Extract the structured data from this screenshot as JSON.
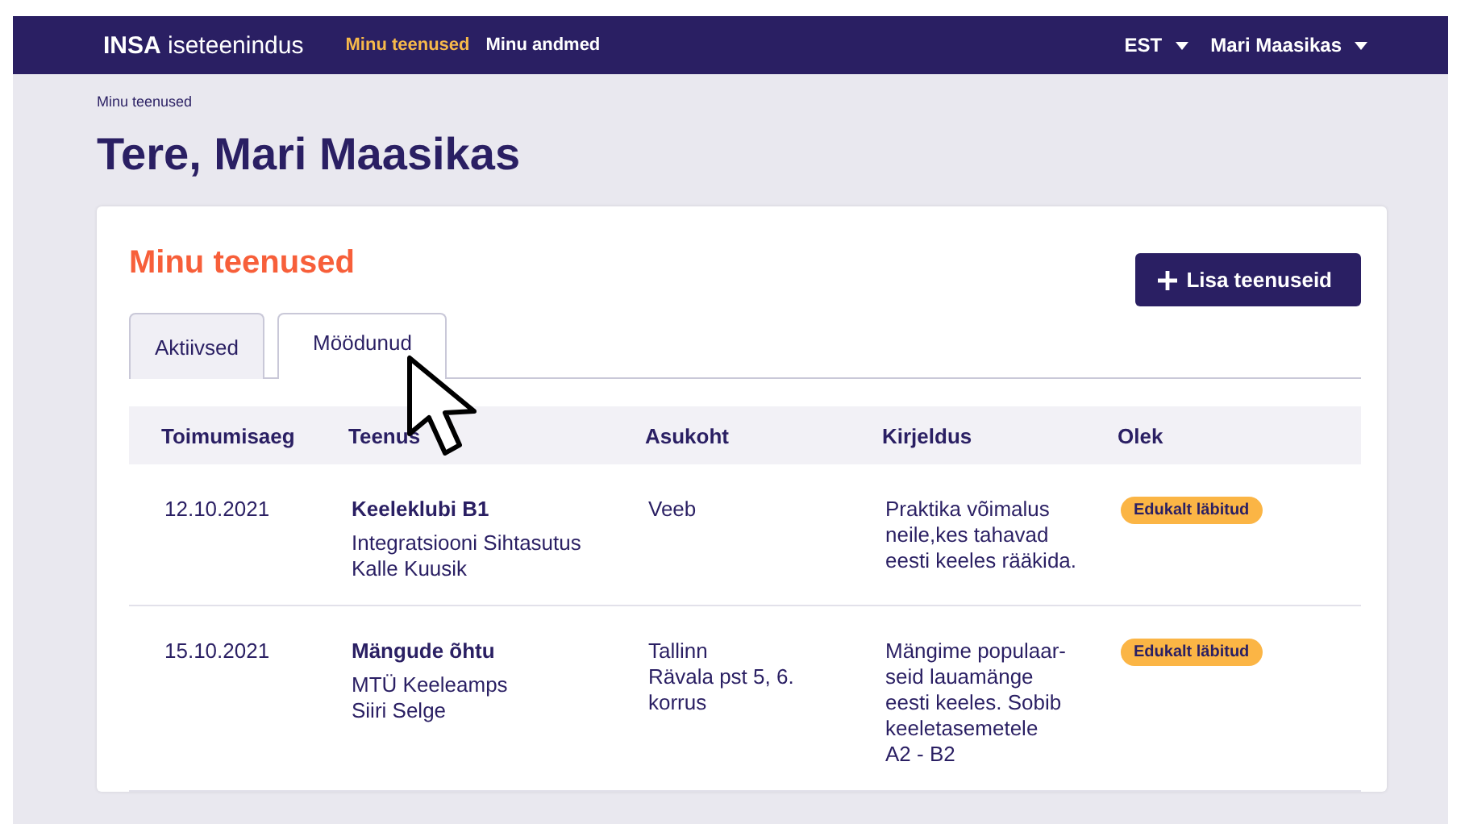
{
  "header": {
    "brand": "**INSA** iseteenindus",
    "nav": [
      {
        "label": "Minu teenused",
        "selected": true
      },
      {
        "label": "Minu andmed",
        "selected": false
      }
    ],
    "language": "EST",
    "user": "Mari Maasikas"
  },
  "breadcrumb": "Minu teenused",
  "greeting": "Tere, Mari Maasikas",
  "services": {
    "title": "Minu teenused",
    "add_button": "Lisa teenuseid",
    "tabs": [
      {
        "label": "Aktiivsed",
        "selected": false
      },
      {
        "label": "Möödunud",
        "selected": true
      }
    ],
    "table": {
      "columns": [
        "Toimumisaeg",
        "Teenus",
        "Asukoht",
        "Kirjeldus",
        "Olek"
      ],
      "rows": [
        {
          "date": "12.10.2021",
          "title": "Keeleklubi B1",
          "provider": [
            "Integratsiooni Sihtasutus",
            "Kalle Kuusik"
          ],
          "location": [
            "Veeb"
          ],
          "description": [
            "Praktika võimalus",
            "neile,kes tahavad",
            "eesti keeles rääkida."
          ],
          "status": "Edukalt läbitud"
        },
        {
          "date": "15.10.2021",
          "title": "Mängude õhtu",
          "provider": [
            "MTÜ Keeleamps",
            "Siiri Selge"
          ],
          "location": [
            "Tallinn",
            "Rävala pst 5, 6.",
            "korrus"
          ],
          "description": [
            "Mängime populaar-",
            "seid lauamänge",
            "eesti keeles.  Sobib",
            "keeletasemetele",
            "A2 - B2"
          ],
          "status": "Edukalt läbitud"
        }
      ]
    }
  }
}
